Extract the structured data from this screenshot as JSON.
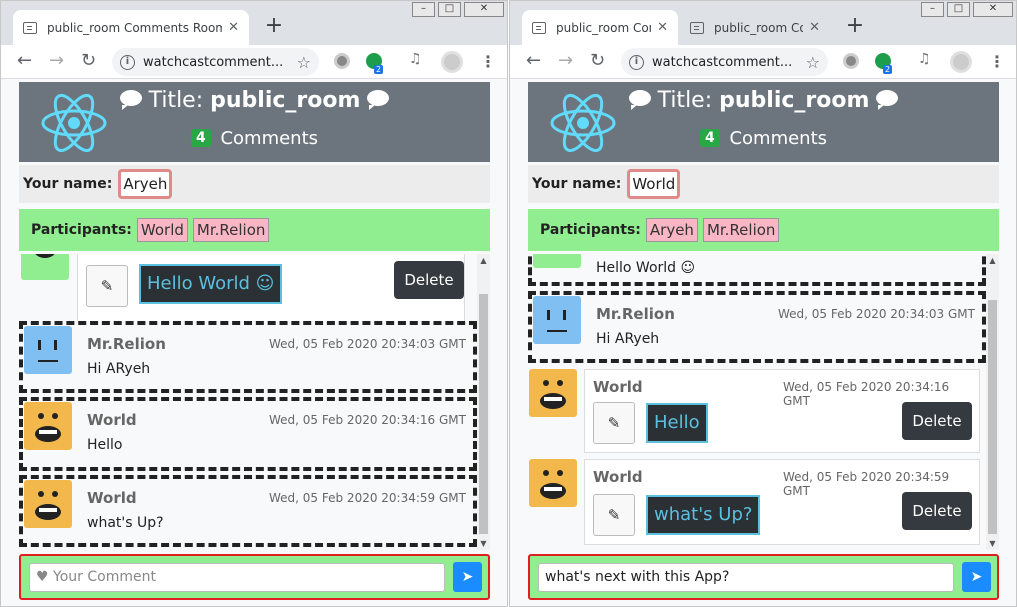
{
  "left": {
    "tabs": [
      {
        "title": "public_room Comments Room",
        "close": "✕"
      }
    ],
    "url": "watchcastcomment...",
    "room": {
      "prefix": "Title:",
      "name": "public_room"
    },
    "comment_count": "4",
    "comments_label": "Comments",
    "your_name_label": "Your name:",
    "your_name": "Aryeh",
    "participants_label": "Participants:",
    "participants": [
      "World",
      "Mr.Relion"
    ],
    "own_comment": {
      "text": "Hello World ☺",
      "delete": "Delete"
    },
    "comments": [
      {
        "author": "Mr.Relion",
        "date": "Wed, 05 Feb 2020 20:34:03 GMT",
        "text": "Hi ARyeh"
      },
      {
        "author": "World",
        "date": "Wed, 05 Feb 2020 20:34:16 GMT",
        "text": "Hello"
      },
      {
        "author": "World",
        "date": "Wed, 05 Feb 2020 20:34:59 GMT",
        "text": "what's Up?"
      }
    ],
    "input": {
      "placeholder": "Your Comment",
      "value": ""
    }
  },
  "right": {
    "tabs": [
      {
        "title": "public_room Com",
        "close": "✕"
      },
      {
        "title": "public_room Com",
        "close": "✕"
      }
    ],
    "url": "watchcastcomment...",
    "room": {
      "prefix": "Title:",
      "name": "public_room"
    },
    "comment_count": "4",
    "comments_label": "Comments",
    "your_name_label": "Your name:",
    "your_name": "World",
    "participants_label": "Participants:",
    "participants": [
      "Aryeh",
      "Mr.Relion"
    ],
    "partial_comment": {
      "text": "Hello World ☺"
    },
    "comments": [
      {
        "author": "Mr.Relion",
        "date": "Wed, 05 Feb 2020 20:34:03 GMT",
        "text": "Hi ARyeh"
      }
    ],
    "own_comments": [
      {
        "author": "World",
        "date": "Wed, 05 Feb 2020 20:34:16 GMT",
        "text": "Hello",
        "delete": "Delete"
      },
      {
        "author": "World",
        "date": "Wed, 05 Feb 2020 20:34:59 GMT",
        "text": "what's Up?",
        "delete": "Delete"
      }
    ],
    "input": {
      "placeholder": "",
      "value": "what's next with this App?"
    }
  },
  "ext_badge": "2",
  "icons": {
    "edit": "✎",
    "send": "➤",
    "heart": "♥"
  },
  "colors": {
    "header": "#6c757d",
    "participants_bg": "#90ee90",
    "badge": "#28a745",
    "send": "#1a8cff",
    "delete": "#343a40",
    "edit_input_border": "#5bc0de"
  }
}
